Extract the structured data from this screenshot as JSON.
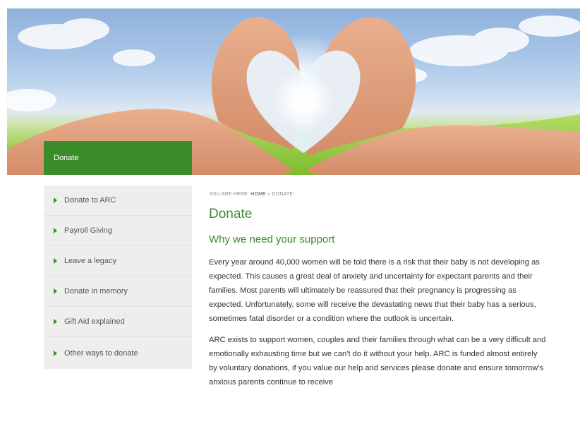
{
  "hero": {
    "tab_label": "Donate"
  },
  "sidebar": {
    "items": [
      {
        "label": "Donate to ARC"
      },
      {
        "label": "Payroll Giving"
      },
      {
        "label": "Leave a legacy"
      },
      {
        "label": "Donate in memory"
      },
      {
        "label": "Gift Aid explained"
      },
      {
        "label": "Other ways to donate"
      }
    ]
  },
  "breadcrumb": {
    "prefix": "YOU ARE HERE:",
    "home": "HOME",
    "separator": "»",
    "current": "DONATE"
  },
  "main": {
    "title": "Donate",
    "subtitle": "Why we need your support",
    "paragraphs": [
      "Every year around 40,000 women will be told there is a risk that their baby is not developing as expected. This causes a great deal of anxiety and uncertainty for expectant parents and their families. Most parents will ultimately be reassured that their pregnancy is progressing as expected. Unfortunately, some will receive the devastating news that their baby has a serious, sometimes fatal disorder or a condition where the outlook is uncertain.",
      "ARC exists to support women, couples and their families through what can be a very difficult and emotionally exhausting time but we can't do it without your help. ARC is funded almost entirely by voluntary donations, if you value our help and services please donate and ensure tomorrow's anxious parents continue to receive"
    ]
  },
  "colors": {
    "accent_green": "#3a8c2b",
    "sidebar_bg": "#eeeeee"
  }
}
